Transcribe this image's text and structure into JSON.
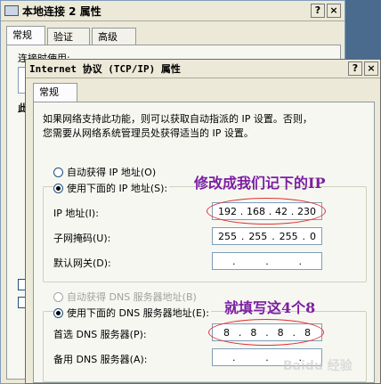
{
  "back_window": {
    "title": "本地连接 2 属性",
    "tabs": [
      "常规",
      "验证",
      "高级"
    ],
    "connect_using_label": "连接时使用:",
    "partial_label": "此"
  },
  "front_window": {
    "title": "Internet 协议 (TCP/IP) 属性",
    "tab": "常规",
    "description": [
      "如果网络支持此功能，则可以获取自动指派的 IP 设置。否则，",
      "您需要从网络系统管理员处获得适当的 IP 设置。"
    ],
    "auto_ip_label": "自动获得 IP 地址(O)",
    "manual_ip_label": "使用下面的 IP 地址(S):",
    "ip_address_label": "IP 地址(I):",
    "ip_address": [
      "192",
      "168",
      "42",
      "230"
    ],
    "subnet_label": "子网掩码(U):",
    "subnet_mask": [
      "255",
      "255",
      "255",
      "0"
    ],
    "gateway_label": "默认网关(D):",
    "auto_dns_label": "自动获得 DNS 服务器地址(B)",
    "manual_dns_label": "使用下面的 DNS 服务器地址(E):",
    "preferred_dns_label": "首选 DNS 服务器(P):",
    "preferred_dns": [
      "8",
      "8",
      "8",
      "8"
    ],
    "alternate_dns_label": "备用 DNS 服务器(A):",
    "help_button": "?",
    "close_button": "×"
  },
  "annotations": {
    "ip_note": "修改成我们记下的IP",
    "dns_note": "就填写这4个8"
  },
  "watermark": "Baidu 经验"
}
